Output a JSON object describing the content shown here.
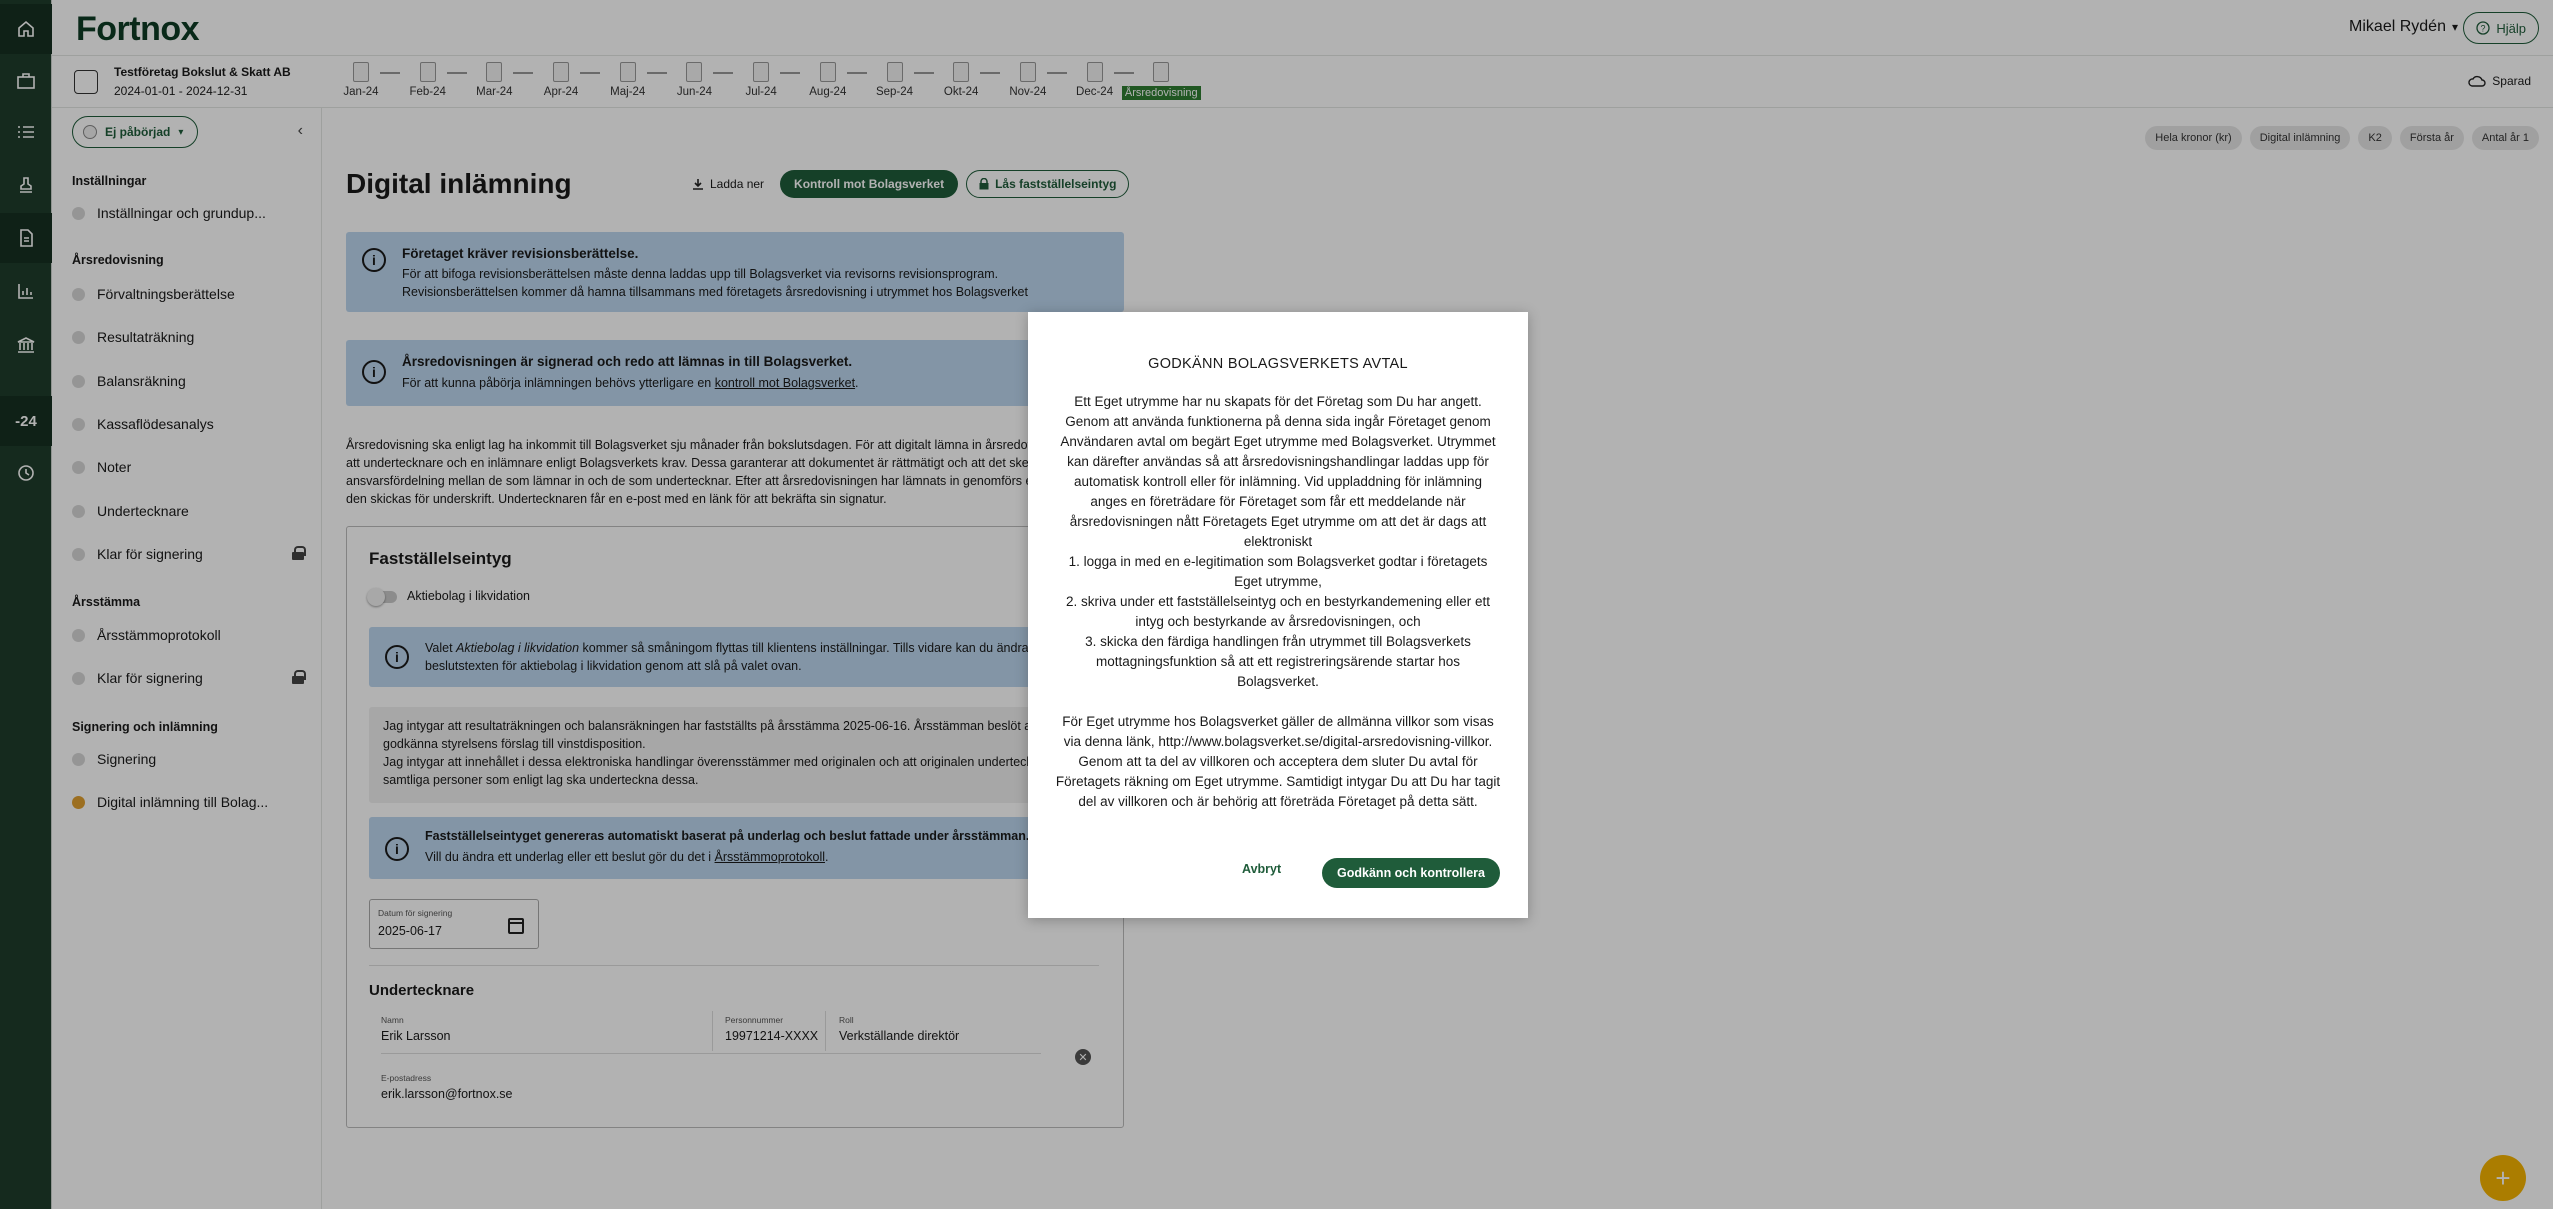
{
  "header": {
    "logo": "Fortnox",
    "user_name": "Mikael Rydén",
    "help_label": "Hjälp"
  },
  "rail": {
    "year_label": "-24"
  },
  "company": {
    "name": "Testföretag Bokslut & Skatt AB",
    "dates": "2024-01-01 - 2024-12-31"
  },
  "periods": [
    "Jan-24",
    "Feb-24",
    "Mar-24",
    "Apr-24",
    "Maj-24",
    "Jun-24",
    "Jul-24",
    "Aug-24",
    "Sep-24",
    "Okt-24",
    "Nov-24",
    "Dec-24",
    "Årsredovisning"
  ],
  "saved_label": "Sparad",
  "sidebar": {
    "status_label": "Ej påbörjad",
    "sections": {
      "installningar": "Inställningar",
      "arsredovisning": "Årsredovisning",
      "arsstamma": "Årsstämma",
      "signering": "Signering och inlämning"
    },
    "items": [
      "Inställningar och grundup...",
      "Förvaltningsberättelse",
      "Resultaträkning",
      "Balansräkning",
      "Kassaflödesanalys",
      "Noter",
      "Undertecknare",
      "Klar för signering",
      "Årsstämmoprotokoll",
      "Klar för signering",
      "Signering",
      "Digital inlämning till Bolag..."
    ]
  },
  "chips": [
    "Hela kronor (kr)",
    "Digital inlämning",
    "K2",
    "Första år",
    "Antal år 1"
  ],
  "main": {
    "title": "Digital inlämning",
    "download_label": "Ladda ner",
    "control_label": "Kontroll mot Bolagsverket",
    "lock_label": "Lås fastställelseintyg",
    "info1_title": "Företaget kräver revisionsberättelse.",
    "info1_text": "För att bifoga revisionsberättelsen måste denna laddas upp till Bolagsverket via revisorns revisionsprogram. Revisionsberättelsen kommer då hamna tillsammans med företagets årsredovisning i utrymmet hos Bolagsverket",
    "info2_title": "Årsredovisningen är signerad och redo att lämnas in till Bolagsverket.",
    "info2_text_a": "För att kunna påbörja inlämningen behövs ytterligare en ",
    "info2_link": "kontroll mot Bolagsverket",
    "info2_text_b": ".",
    "paragraph": "Årsredovisning ska enligt lag ha inkommit till Bolagsverket sju månader från bokslutsdagen. För att digitalt lämna in årsredovisningen krävs att undertecknare och en inlämnare enligt Bolagsverkets krav. Dessa garanterar att dokumentet är rättmätigt och att det sker en ansvarsfördelning mellan de som lämnar in och de som undertecknar. Efter att årsredovisningen har lämnats in genomförs en kontroll och den skickas för underskrift. Undertecknaren får en e-post med en länk för att bekräfta sin signatur."
  },
  "card": {
    "title": "Fastställelseintyg",
    "toggle_label": "Aktiebolag i likvidation",
    "info_a": "Valet ",
    "info_italic": "Aktiebolag i likvidation",
    "info_b": " kommer så småningom flyttas till klientens inställningar. Tills vidare kan du ändra beslutstexten för aktiebolag i likvidation genom att slå på valet ovan.",
    "grey_text_1": "Jag intygar att resultaträkningen och balansräkningen har fastställts på årsstämma 2025-06-16. Årsstämman beslöt att godkänna styrelsens förslag till vinstdisposition.",
    "grey_text_2": "Jag intygar att innehållet i dessa elektroniska handlingar överensstämmer med originalen och att originalen undertecknats av samtliga personer som enligt lag ska underteckna dessa.",
    "info2_title": "Fastställelseintyget genereras automatiskt baserat på underlag och beslut fattade under årsstämman.",
    "info2_text_a": "Vill du ändra ett underlag eller ett beslut gör du det i ",
    "info2_link": "Årsstämmoprotokoll",
    "info2_text_b": ".",
    "date_label": "Datum för signering",
    "date_value": "2025-06-17",
    "signers_title": "Undertecknare",
    "name_label": "Namn",
    "name_value": "Erik Larsson",
    "pnr_label": "Personnummer",
    "pnr_value": "19971214-XXXX",
    "role_label": "Roll",
    "role_value": "Verkställande direktör",
    "email_label": "E-postadress",
    "email_value": "erik.larsson@fortnox.se"
  },
  "modal": {
    "title": "GODKÄNN BOLAGSVERKETS AVTAL",
    "body_1": "Ett Eget utrymme har nu skapats för det Företag som Du har angett. Genom att använda funktionerna på denna sida ingår Företaget genom Användaren avtal om begärt Eget utrymme med Bolagsverket. Utrymmet kan därefter användas så att årsredovisningshandlingar laddas upp för automatisk kontroll eller för inlämning. Vid uppladdning för inlämning anges en företrädare för Företaget som får ett meddelande när årsredovisningen nått Företagets Eget utrymme om att det är dags att elektroniskt\n1. logga in med en e-legitimation som Bolagsverket godtar i företagets Eget utrymme,\n2. skriva under ett fastställelseintyg och en bestyrkandemening eller ett intyg och bestyrkande av årsredovisningen, och\n3. skicka den färdiga handlingen från utrymmet till Bolagsverkets mottagningsfunktion så att ett registreringsärende startar hos Bolagsverket.",
    "body_2": "För Eget utrymme hos Bolagsverket gäller de allmänna villkor som visas via denna länk, http://www.bolagsverket.se/digital-arsredovisning-villkor. Genom att ta del av villkoren och acceptera dem sluter Du avtal för Företagets räkning om Eget utrymme. Samtidigt intygar Du att Du har tagit del av villkoren och är behörig att företräda Företaget på detta sätt.",
    "cancel_label": "Avbryt",
    "approve_label": "Godkänn och kontrollera"
  }
}
